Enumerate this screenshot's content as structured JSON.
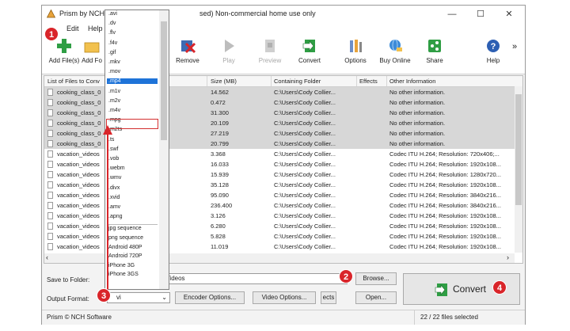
{
  "window": {
    "title_visible": "Prism by NCH",
    "title_rest": "sed) Non-commercial home use only",
    "minimize": "—",
    "maximize": "☐",
    "close": "✕"
  },
  "menu": [
    "Edit",
    "Help"
  ],
  "toolbar": {
    "add_files": "Add File(s)",
    "add_folder": "Add Fo",
    "remove": "Remove",
    "play": "Play",
    "preview": "Preview",
    "convert": "Convert",
    "options": "Options",
    "buy_online": "Buy Online",
    "share": "Share",
    "help": "Help",
    "more": "»"
  },
  "list": {
    "headers": {
      "name": "List of Files to Conv",
      "size": "Size (MB)",
      "folder": "Containing Folder",
      "effects": "Effects",
      "info": "Other Information"
    },
    "rows": [
      {
        "name": "cooking_class_0",
        "size": "14.562",
        "folder": "C:\\Users\\Cody Collier...",
        "info": "No other information."
      },
      {
        "name": "cooking_class_0",
        "size": "0.472",
        "folder": "C:\\Users\\Cody Collier...",
        "info": "No other information."
      },
      {
        "name": "cooking_class_0",
        "size": "31.300",
        "folder": "C:\\Users\\Cody Collier...",
        "info": "No other information."
      },
      {
        "name": "cooking_class_0",
        "size": "20.109",
        "folder": "C:\\Users\\Cody Collier...",
        "info": "No other information."
      },
      {
        "name": "cooking_class_0",
        "size": "27.219",
        "folder": "C:\\Users\\Cody Collier...",
        "info": "No other information."
      },
      {
        "name": "cooking_class_0",
        "size": "20.799",
        "folder": "C:\\Users\\Cody Collier...",
        "info": "No other information."
      },
      {
        "name": "vacation_videos",
        "size": "3.368",
        "folder": "C:\\Users\\Cody Collier...",
        "info": "Codec ITU H.264; Resolution: 720x406;..."
      },
      {
        "name": "vacation_videos",
        "size": "16.033",
        "folder": "C:\\Users\\Cody Collier...",
        "info": "Codec ITU H.264; Resolution: 1920x108..."
      },
      {
        "name": "vacation_videos",
        "size": "15.939",
        "folder": "C:\\Users\\Cody Collier...",
        "info": "Codec ITU H.264; Resolution: 1280x720..."
      },
      {
        "name": "vacation_videos",
        "size": "35.128",
        "folder": "C:\\Users\\Cody Collier...",
        "info": "Codec ITU H.264; Resolution: 1920x108..."
      },
      {
        "name": "vacation_videos",
        "size": "95.090",
        "folder": "C:\\Users\\Cody Collier...",
        "info": "Codec ITU H.264; Resolution: 3840x216..."
      },
      {
        "name": "vacation_videos",
        "size": "236.400",
        "folder": "C:\\Users\\Cody Collier...",
        "info": "Codec ITU H.264; Resolution: 3840x216..."
      },
      {
        "name": "vacation_videos",
        "size": "3.126",
        "folder": "C:\\Users\\Cody Collier...",
        "info": "Codec ITU H.264; Resolution: 1920x108..."
      },
      {
        "name": "vacation_videos",
        "size": "6.280",
        "folder": "C:\\Users\\Cody Collier...",
        "info": "Codec ITU H.264; Resolution: 1920x108..."
      },
      {
        "name": "vacation_videos",
        "size": "5.828",
        "folder": "C:\\Users\\Cody Collier...",
        "info": "Codec ITU H.264; Resolution: 1920x108..."
      },
      {
        "name": "vacation_videos",
        "size": "11.019",
        "folder": "C:\\Users\\Cody Collier...",
        "info": "Codec ITU H.264; Resolution: 1920x108..."
      }
    ]
  },
  "dropdown": {
    "formats": [
      ".avi",
      ".dv",
      ".flv",
      ".f4v",
      ".gif",
      ".mkv",
      ".mov",
      ".mp4",
      ".m1v",
      ".m2v",
      ".m4v",
      ".mpg",
      ".m2ts",
      ".ts",
      ".swf",
      ".vob",
      ".webm",
      ".wmv",
      ".divx",
      ".xvid",
      ".amv",
      ".apng"
    ],
    "highlighted": ".mp4",
    "presets": [
      "jpg sequence",
      "png sequence",
      "Android 480P",
      "Android 720P",
      "iPhone 3G",
      "iPhone 3GS"
    ]
  },
  "bottom": {
    "save_label": "Save to Folder:",
    "save_path": "\\Videos",
    "browse": "Browse...",
    "output_label": "Output Format:",
    "output_value": "vi",
    "encoder": "Encoder Options...",
    "video": "Video Options...",
    "effects_partial": "ects",
    "open": "Open...",
    "convert": "Convert"
  },
  "status": {
    "left": "Prism © NCH Software",
    "right": "22 / 22 files selected"
  },
  "markers": {
    "m1": "1",
    "m2": "2",
    "m3": "3",
    "m4": "4"
  },
  "colors": {
    "marker": "#d9252a",
    "highlight": "#1e73d8",
    "accent_green": "#2f9e44"
  }
}
